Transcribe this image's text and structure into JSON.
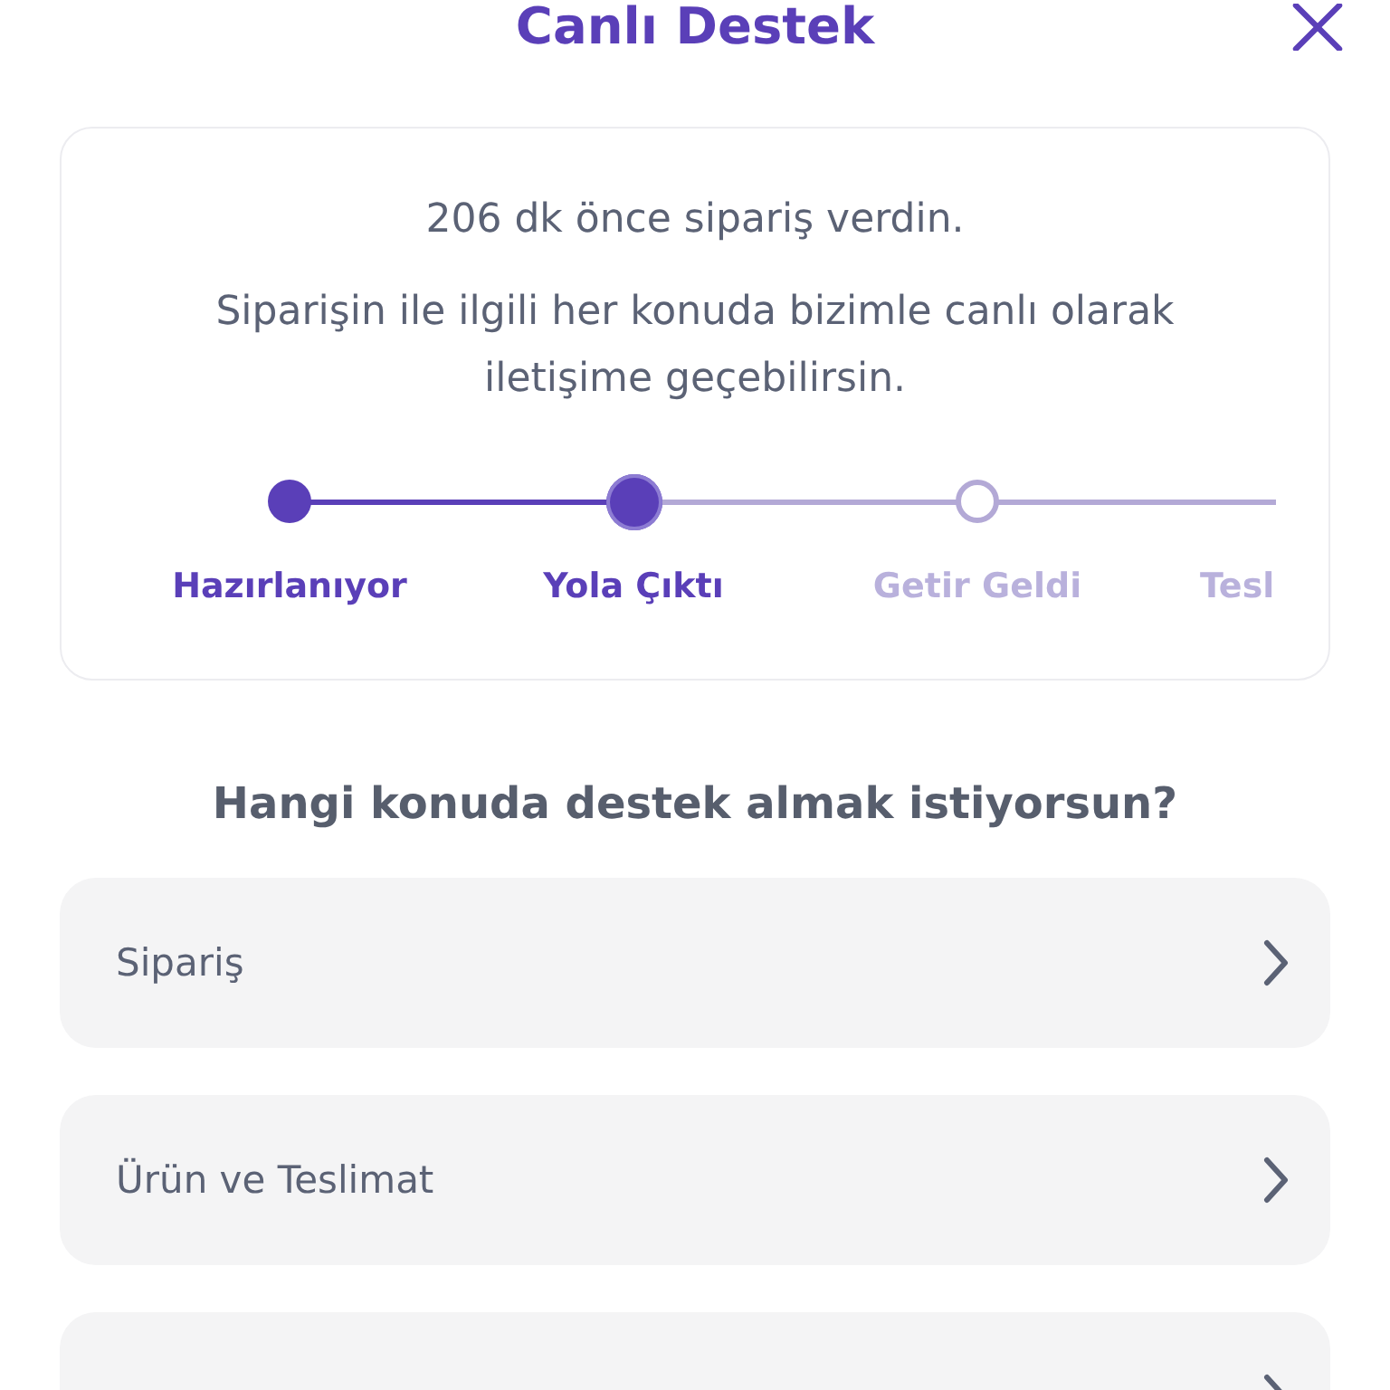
{
  "header": {
    "title": "Canlı Destek"
  },
  "order_card": {
    "elapsed": "206 dk önce sipariş verdin.",
    "message": "Siparişin ile ilgili her konuda bizimle canlı olarak iletişime geçebilirsin.",
    "steps": [
      {
        "label": "Hazırlanıyor",
        "reached": true
      },
      {
        "label": "Yola Çıktı",
        "reached": true
      },
      {
        "label": "Getir Geldi",
        "reached": false
      },
      {
        "label": "Tesl",
        "reached": false
      }
    ]
  },
  "question": "Hangi konuda destek almak istiyorsun?",
  "topics": [
    {
      "kind": "row",
      "label": "Sipariş"
    },
    {
      "kind": "row",
      "label": "Ürün ve Teslimat"
    },
    {
      "kind": "cut"
    }
  ]
}
